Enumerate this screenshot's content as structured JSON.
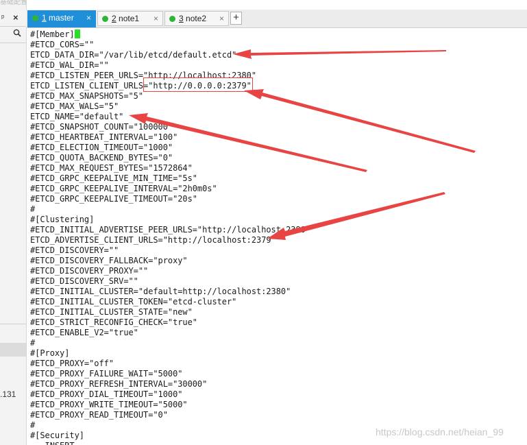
{
  "window": {
    "title": "基础配置"
  },
  "left_panel": {
    "pin_icon": "pin-icon",
    "close_glyph": "×",
    "search_icon": "search-icon",
    "partial_text": ".131"
  },
  "tabs": [
    {
      "number": "1",
      "name": "master",
      "active": true,
      "status_color": "#2fb536"
    },
    {
      "number": "2",
      "name": "note1",
      "active": false,
      "status_color": "#2fb536"
    },
    {
      "number": "3",
      "name": "note2",
      "active": false,
      "status_color": "#2fb536"
    }
  ],
  "tab_close_glyph": "×",
  "add_tab_label": "+",
  "editor": {
    "lines": [
      "#[Member]",
      "#ETCD_CORS=\"\"",
      "ETCD_DATA_DIR=\"/var/lib/etcd/default.etcd\"",
      "#ETCD_WAL_DIR=\"\"",
      "#ETCD_LISTEN_PEER_URLS=\"http://localhost:2380\"",
      "ETCD_LISTEN_CLIENT_URLS=\"http://0.0.0.0:2379\"",
      "#ETCD_MAX_SNAPSHOTS=\"5\"",
      "#ETCD_MAX_WALS=\"5\"",
      "ETCD_NAME=\"default\"",
      "#ETCD_SNAPSHOT_COUNT=\"100000\"",
      "#ETCD_HEARTBEAT_INTERVAL=\"100\"",
      "#ETCD_ELECTION_TIMEOUT=\"1000\"",
      "#ETCD_QUOTA_BACKEND_BYTES=\"0\"",
      "#ETCD_MAX_REQUEST_BYTES=\"1572864\"",
      "#ETCD_GRPC_KEEPALIVE_MIN_TIME=\"5s\"",
      "#ETCD_GRPC_KEEPALIVE_INTERVAL=\"2h0m0s\"",
      "#ETCD_GRPC_KEEPALIVE_TIMEOUT=\"20s\"",
      "#",
      "#[Clustering]",
      "#ETCD_INITIAL_ADVERTISE_PEER_URLS=\"http://localhost:2380\"",
      "ETCD_ADVERTISE_CLIENT_URLS=\"http://localhost:2379\"",
      "#ETCD_DISCOVERY=\"\"",
      "#ETCD_DISCOVERY_FALLBACK=\"proxy\"",
      "#ETCD_DISCOVERY_PROXY=\"\"",
      "#ETCD_DISCOVERY_SRV=\"\"",
      "#ETCD_INITIAL_CLUSTER=\"default=http://localhost:2380\"",
      "#ETCD_INITIAL_CLUSTER_TOKEN=\"etcd-cluster\"",
      "#ETCD_INITIAL_CLUSTER_STATE=\"new\"",
      "#ETCD_STRICT_RECONFIG_CHECK=\"true\"",
      "#ETCD_ENABLE_V2=\"true\"",
      "#",
      "#[Proxy]",
      "#ETCD_PROXY=\"off\"",
      "#ETCD_PROXY_FAILURE_WAIT=\"5000\"",
      "#ETCD_PROXY_REFRESH_INTERVAL=\"30000\"",
      "#ETCD_PROXY_DIAL_TIMEOUT=\"1000\"",
      "#ETCD_PROXY_WRITE_TIMEOUT=\"5000\"",
      "#ETCD_PROXY_READ_TIMEOUT=\"0\"",
      "#",
      "#[Security]",
      "-- INSERT --"
    ],
    "cursor_color": "#28e028"
  },
  "annotations": {
    "arrow_color": "#e84444"
  },
  "watermark": "https://blog.csdn.net/heian_99"
}
